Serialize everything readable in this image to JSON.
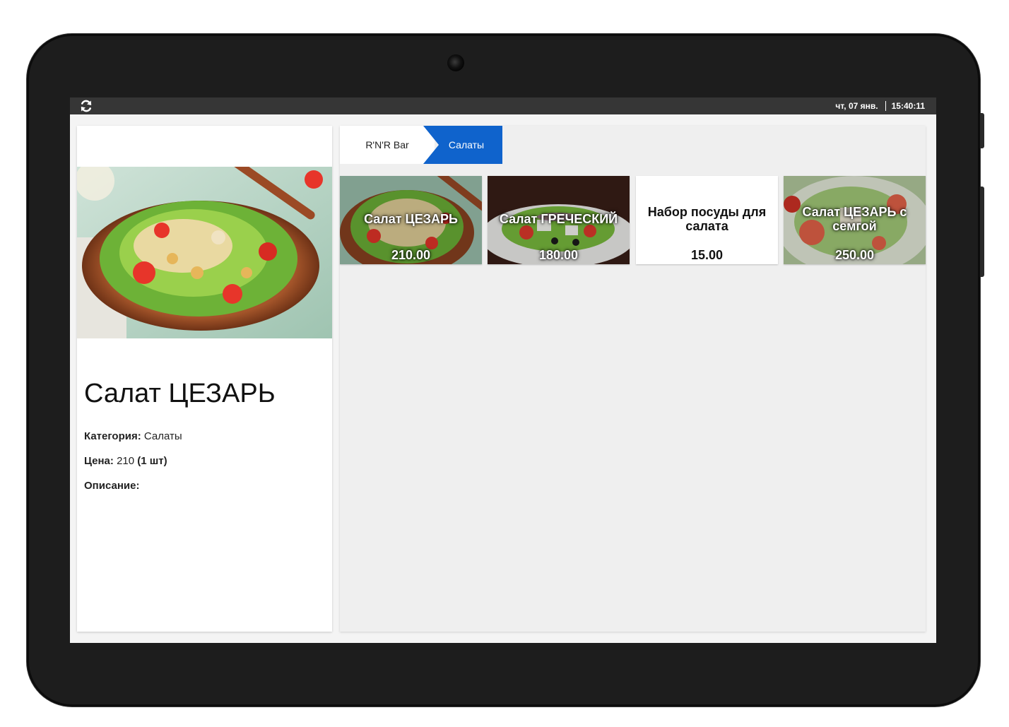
{
  "statusbar": {
    "refresh_icon": "refresh-icon",
    "date": "чт, 07 янв.",
    "time": "15:40:11"
  },
  "product": {
    "title": "Салат ЦЕЗАРЬ",
    "category_label": "Категория:",
    "category_value": "Салаты",
    "price_label": "Цена:",
    "price_value": "210",
    "price_unit": "(1 шт)",
    "description_label": "Описание:"
  },
  "breadcrumb": {
    "home": "R'N'R Bar",
    "current": "Салаты"
  },
  "tiles": [
    {
      "name": "Салат ЦЕЗАРЬ",
      "price": "210.00"
    },
    {
      "name": "Салат ГРЕЧЕСКИЙ",
      "price": "180.00"
    },
    {
      "name": "Набор посуды для салата",
      "price": "15.00"
    },
    {
      "name": "Салат ЦЕЗАРЬ с семгой",
      "price": "250.00"
    }
  ],
  "colors": {
    "accent": "#0f63cc",
    "statusbar": "#363636",
    "bezel": "#1d1d1d"
  }
}
